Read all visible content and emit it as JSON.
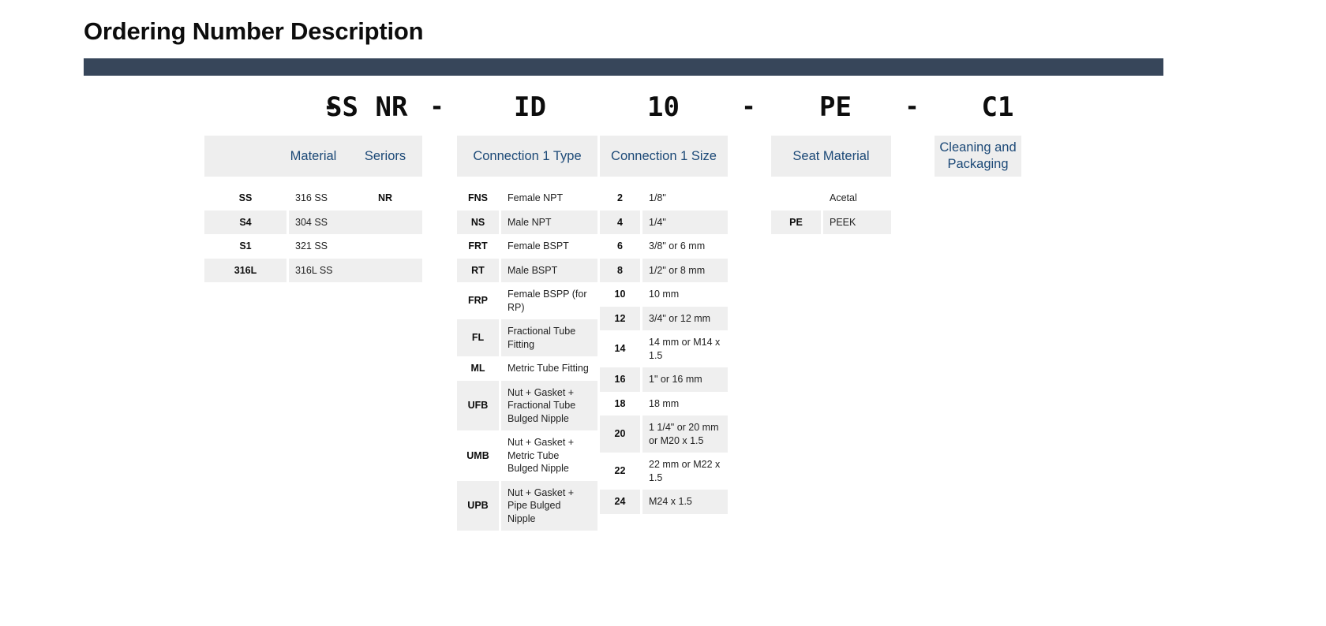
{
  "page": {
    "title": "Ordering Number Description",
    "bar_color": "#37465a",
    "header_text_color": "#1c4977",
    "header_bg_color": "#eeeeee",
    "stripe_color": "#efefef"
  },
  "part_number": {
    "segments": [
      "SS",
      "NR",
      "ID",
      "10",
      "PE",
      "C1"
    ],
    "separator": "-",
    "full": "SS - NR - ID10 - PE - C1"
  },
  "columns": [
    {
      "key": "material",
      "header": "Material",
      "rows": [
        {
          "code": "SS",
          "desc": "316 SS"
        },
        {
          "code": "S4",
          "desc": "304 SS"
        },
        {
          "code": "S1",
          "desc": "321 SS"
        },
        {
          "code": "316L",
          "desc": "316L SS"
        }
      ]
    },
    {
      "key": "series",
      "header": "Seriors",
      "rows": [
        {
          "code": "NR",
          "desc": ""
        }
      ]
    },
    {
      "key": "connection1_type",
      "header": "Connection 1 Type",
      "rows": [
        {
          "code": "FNS",
          "desc": "Female NPT"
        },
        {
          "code": "NS",
          "desc": "Male NPT"
        },
        {
          "code": "FRT",
          "desc": "Female BSPT"
        },
        {
          "code": "RT",
          "desc": "Male BSPT"
        },
        {
          "code": "FRP",
          "desc": "Female BSPP (for RP)"
        },
        {
          "code": "FL",
          "desc": "Fractional Tube Fitting"
        },
        {
          "code": "ML",
          "desc": "Metric Tube Fitting"
        },
        {
          "code": "UFB",
          "desc": "Nut + Gasket + Fractional Tube Bulged Nipple"
        },
        {
          "code": "UMB",
          "desc": "Nut + Gasket + Metric Tube Bulged Nipple"
        },
        {
          "code": "UPB",
          "desc": "Nut + Gasket + Pipe Bulged Nipple"
        }
      ]
    },
    {
      "key": "connection1_size",
      "header": "Connection 1 Size",
      "rows": [
        {
          "code": "2",
          "desc": "1/8\""
        },
        {
          "code": "4",
          "desc": "1/4\""
        },
        {
          "code": "6",
          "desc": "3/8\" or 6 mm"
        },
        {
          "code": "8",
          "desc": "1/2\" or 8 mm"
        },
        {
          "code": "10",
          "desc": "10 mm"
        },
        {
          "code": "12",
          "desc": "3/4\" or 12 mm"
        },
        {
          "code": "14",
          "desc": "14 mm or M14 x 1.5"
        },
        {
          "code": "16",
          "desc": "1\" or 16 mm"
        },
        {
          "code": "18",
          "desc": "18 mm"
        },
        {
          "code": "20",
          "desc": "1 1/4\" or 20 mm or M20 x 1.5"
        },
        {
          "code": "22",
          "desc": "22 mm or M22 x 1.5"
        },
        {
          "code": "24",
          "desc": "M24 x 1.5"
        }
      ]
    },
    {
      "key": "seat_material",
      "header": "Seat Material",
      "rows": [
        {
          "code": "",
          "desc": "Acetal"
        },
        {
          "code": "PE",
          "desc": "PEEK"
        }
      ]
    },
    {
      "key": "cleaning_packaging",
      "header": "Cleaning and Packaging",
      "rows": []
    }
  ]
}
